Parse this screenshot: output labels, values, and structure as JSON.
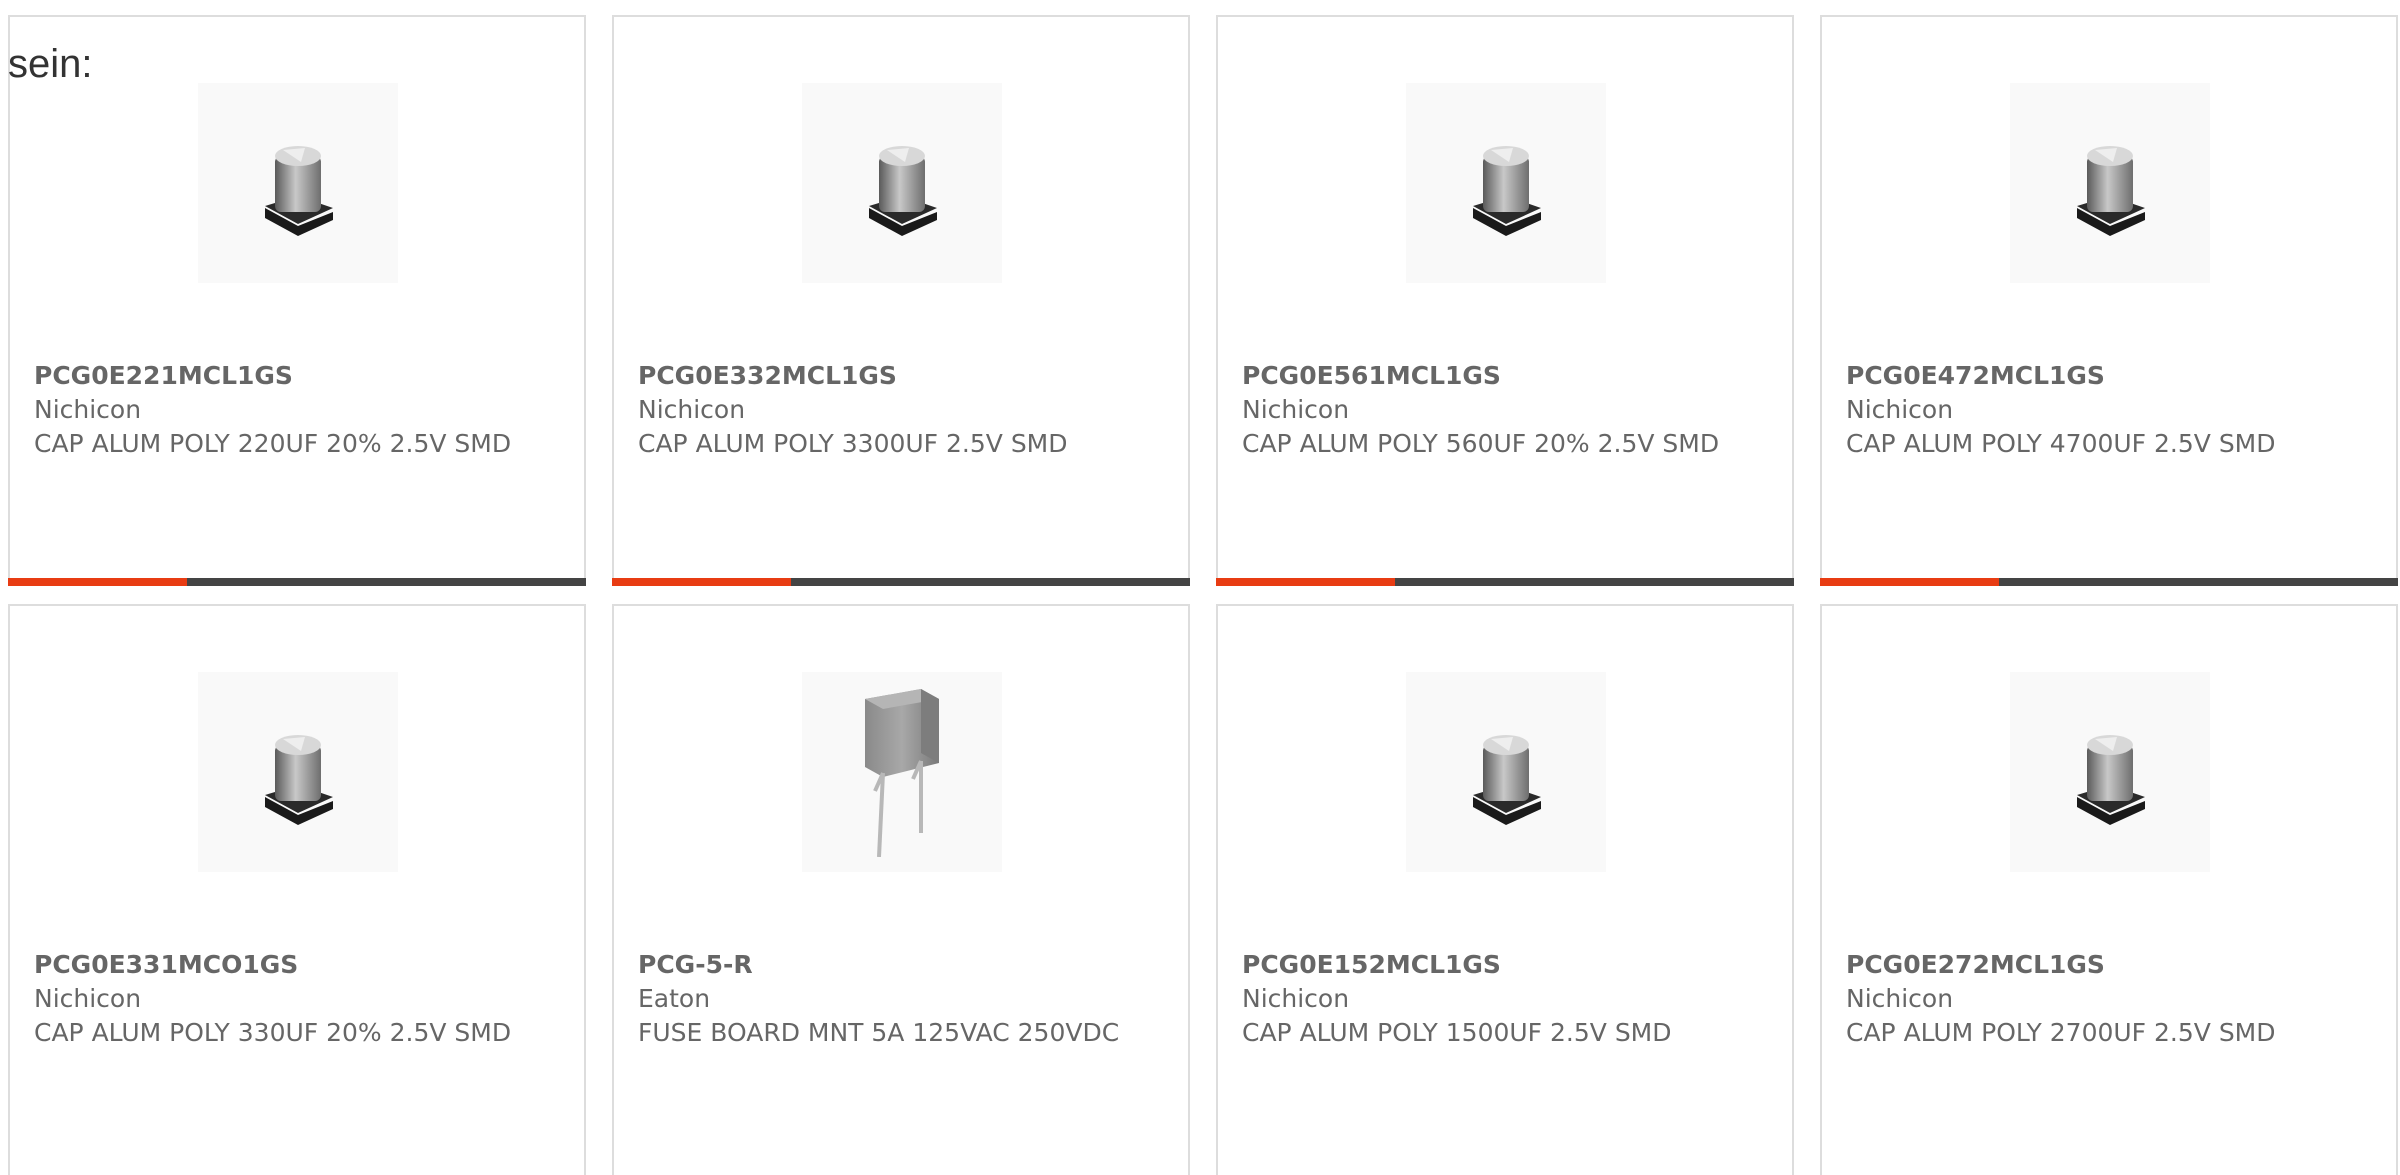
{
  "page": {
    "intro_text": "sein:"
  },
  "accent_color": "#e83c13",
  "products": [
    {
      "part_number": "PCG0E221MCL1GS",
      "manufacturer": "Nichicon",
      "description": "CAP ALUM POLY 220UF 20% 2.5V SMD",
      "image_icon": "smd-capacitor-icon",
      "progress": 0.31
    },
    {
      "part_number": "PCG0E332MCL1GS",
      "manufacturer": "Nichicon",
      "description": "CAP ALUM POLY 3300UF 2.5V SMD",
      "image_icon": "smd-capacitor-icon",
      "progress": 0.31
    },
    {
      "part_number": "PCG0E561MCL1GS",
      "manufacturer": "Nichicon",
      "description": "CAP ALUM POLY 560UF 20% 2.5V SMD",
      "image_icon": "smd-capacitor-icon",
      "progress": 0.31
    },
    {
      "part_number": "PCG0E472MCL1GS",
      "manufacturer": "Nichicon",
      "description": "CAP ALUM POLY 4700UF 2.5V SMD",
      "image_icon": "smd-capacitor-icon",
      "progress": 0.31
    },
    {
      "part_number": "PCG0E331MCO1GS",
      "manufacturer": "Nichicon",
      "description": "CAP ALUM POLY 330UF 20% 2.5V SMD",
      "image_icon": "smd-capacitor-icon"
    },
    {
      "part_number": "PCG-5-R",
      "manufacturer": "Eaton",
      "description": "FUSE BOARD MNT 5A 125VAC 250VDC",
      "image_icon": "board-fuse-icon"
    },
    {
      "part_number": "PCG0E152MCL1GS",
      "manufacturer": "Nichicon",
      "description": "CAP ALUM POLY 1500UF 2.5V SMD",
      "image_icon": "smd-capacitor-icon"
    },
    {
      "part_number": "PCG0E272MCL1GS",
      "manufacturer": "Nichicon",
      "description": "CAP ALUM POLY 2700UF 2.5V SMD",
      "image_icon": "smd-capacitor-icon"
    }
  ]
}
